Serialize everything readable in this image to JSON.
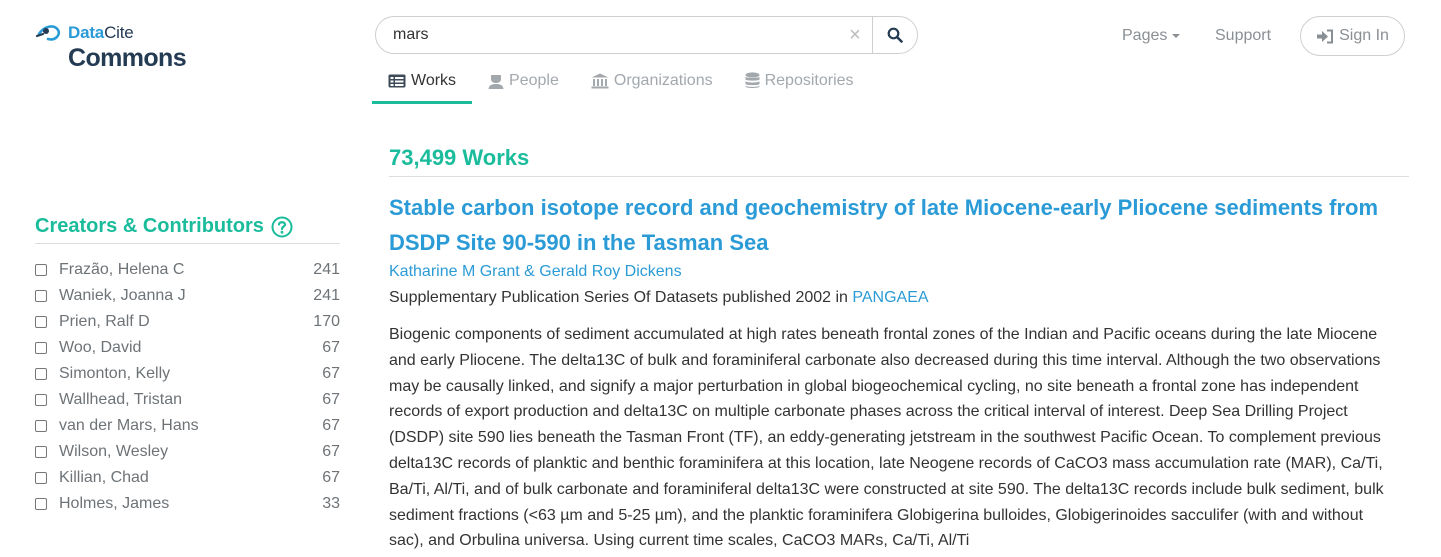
{
  "brand": {
    "top_part1": "Data",
    "top_part2": "Cite",
    "name": "Commons"
  },
  "search": {
    "value": "mars",
    "clear_glyph": "×"
  },
  "nav": {
    "pages_label": "Pages",
    "support_label": "Support",
    "signin_label": "Sign In"
  },
  "tabs": [
    {
      "label": "Works",
      "icon": "list-icon",
      "active": true
    },
    {
      "label": "People",
      "icon": "user-icon",
      "active": false
    },
    {
      "label": "Organizations",
      "icon": "institution-icon",
      "active": false
    },
    {
      "label": "Repositories",
      "icon": "database-icon",
      "active": false
    }
  ],
  "sidebar": {
    "title": "Creators & Contributors",
    "facets": [
      {
        "name": "Frazão, Helena C",
        "count": "241"
      },
      {
        "name": "Waniek, Joanna J",
        "count": "241"
      },
      {
        "name": "Prien, Ralf D",
        "count": "170"
      },
      {
        "name": "Woo, David",
        "count": "67"
      },
      {
        "name": "Simonton, Kelly",
        "count": "67"
      },
      {
        "name": "Wallhead, Tristan",
        "count": "67"
      },
      {
        "name": "van der Mars, Hans",
        "count": "67"
      },
      {
        "name": "Wilson, Wesley",
        "count": "67"
      },
      {
        "name": "Killian, Chad",
        "count": "67"
      },
      {
        "name": "Holmes, James",
        "count": "33"
      }
    ]
  },
  "results": {
    "count_label": "73,499 Works",
    "work": {
      "title": "Stable carbon isotope record and geochemistry of late Miocene-early Pliocene sediments from DSDP Site 90-590 in the Tasman Sea",
      "authors": "Katharine M Grant & Gerald Roy Dickens",
      "pub_text": "Supplementary Publication Series Of Datasets published 2002 in",
      "publisher": "PANGAEA",
      "description": "Biogenic components of sediment accumulated at high rates beneath frontal zones of the Indian and Pacific oceans during the late Miocene and early Pliocene. The delta13C of bulk and foraminiferal carbonate also decreased during this time interval. Although the two observations may be causally linked, and signify a major perturbation in global biogeochemical cycling, no site beneath a frontal zone has independent records of export production and delta13C on multiple carbonate phases across the critical interval of interest. Deep Sea Drilling Project (DSDP) site 590 lies beneath the Tasman Front (TF), an eddy-generating jetstream in the southwest Pacific Ocean. To complement previous delta13C records of planktic and benthic foraminifera at this location, late Neogene records of CaCO3 mass accumulation rate (MAR), Ca/Ti, Ba/Ti, Al/Ti, and of bulk carbonate and foraminiferal delta13C were constructed at site 590. The delta13C records include bulk sediment, bulk sediment fractions (<63 µm and 5-25 µm), and the planktic foraminifera Globigerina bulloides, Globigerinoides sacculifer (with and without sac), and Orbulina universa. Using current time scales, CaCO3 MARs, Ca/Ti, Al/Ti"
    }
  },
  "colors": {
    "accent": "#1abc9c",
    "link": "#2a9bd6",
    "brand_dark": "#243b54",
    "muted": "#8a8f94"
  }
}
